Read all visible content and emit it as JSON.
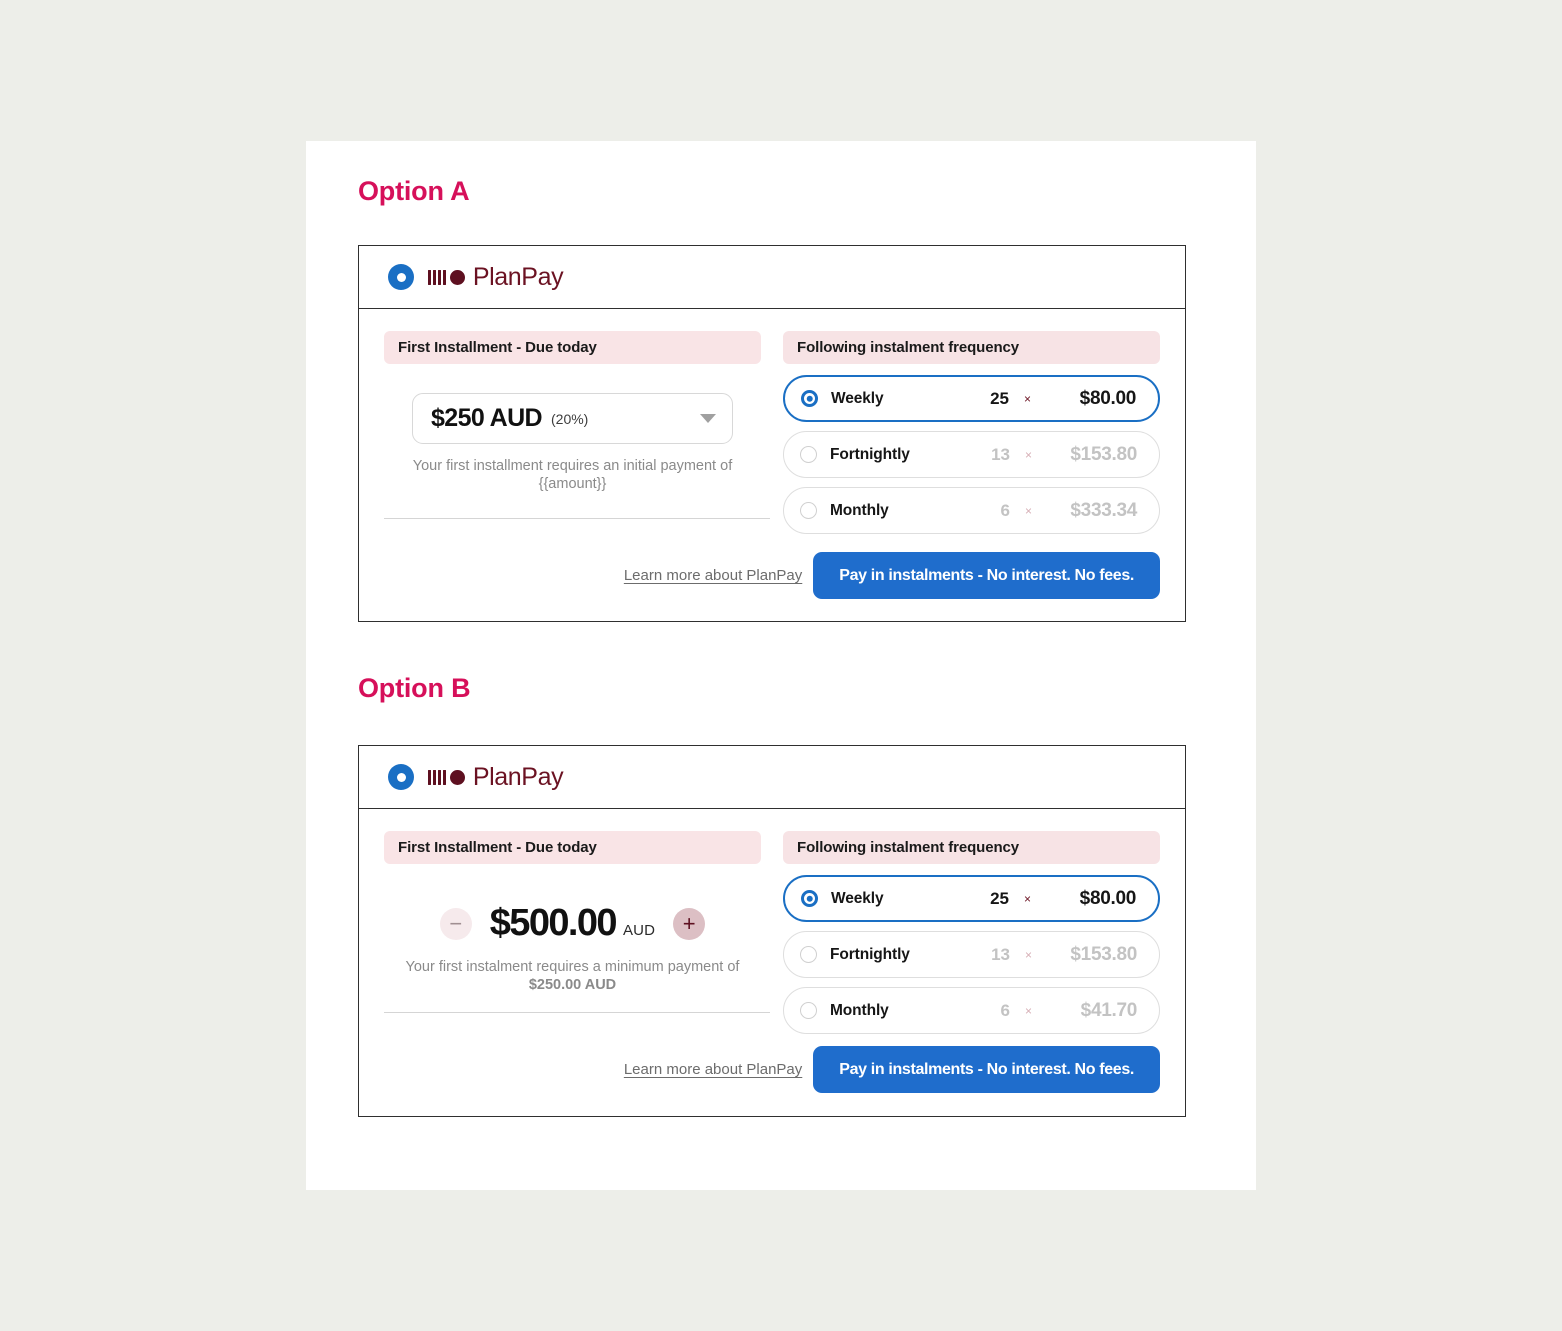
{
  "page": {
    "background_color": "#edeee9",
    "panel_color": "#ffffff"
  },
  "accent": {
    "heading_pink": "#d6105a",
    "brand_maroon": "#6b1222",
    "selected_blue": "#1a6fc4",
    "cta_blue": "#1f6dcc",
    "pill_pink": "#f9e4e6"
  },
  "brand": {
    "name": "PlanPay",
    "logo_mark_icon": "planpay-radio-logo-icon",
    "logo_bars_icon": "planpay-bars-icon"
  },
  "option_a": {
    "title": "Option A",
    "left": {
      "pill_label": "First Installment  -  Due today",
      "select": {
        "amount": "$250 AUD",
        "percent": "(20%)",
        "caret_icon": "chevron-down-icon"
      },
      "helper_line1": "Your first installment requires an initial payment",
      "helper_line2": "of {{amount}}"
    },
    "right": {
      "pill_label": "Following instalment frequency",
      "rows": [
        {
          "label": "Weekly",
          "count": "25",
          "times": "×",
          "price": "$80.00",
          "selected": true
        },
        {
          "label": "Fortnightly",
          "count": "13",
          "times": "×",
          "price": "$153.80",
          "selected": false
        },
        {
          "label": "Monthly",
          "count": "6",
          "times": "×",
          "price": "$333.34",
          "selected": false
        }
      ]
    },
    "footer": {
      "learn_more": "Learn more about PlanPay",
      "cta": "Pay in instalments - No interest. No fees."
    }
  },
  "option_b": {
    "title": "Option B",
    "left": {
      "pill_label": "First Installment  -  Due today",
      "stepper": {
        "minus_label": "−",
        "plus_label": "+",
        "amount": "$500.00",
        "currency": "AUD"
      },
      "helper_line1": "Your first instalment requires a minimum",
      "helper_line2_prefix": "payment of ",
      "helper_line2_strong": "$250.00 AUD"
    },
    "right": {
      "pill_label": "Following instalment frequency",
      "rows": [
        {
          "label": "Weekly",
          "count": "25",
          "times": "×",
          "price": "$80.00",
          "selected": true
        },
        {
          "label": "Fortnightly",
          "count": "13",
          "times": "×",
          "price": "$153.80",
          "selected": false
        },
        {
          "label": "Monthly",
          "count": "6",
          "times": "×",
          "price": "$41.70",
          "selected": false
        }
      ]
    },
    "footer": {
      "learn_more": "Learn more about PlanPay",
      "cta": "Pay in instalments - No interest. No fees."
    }
  }
}
